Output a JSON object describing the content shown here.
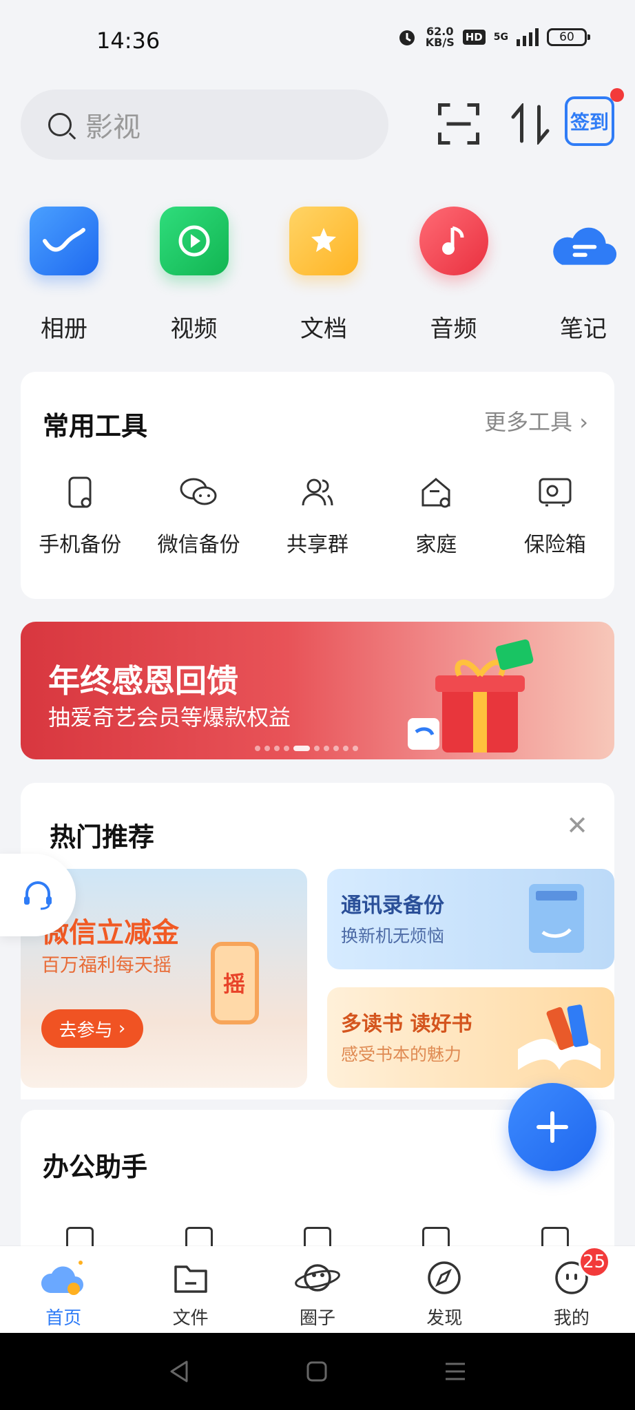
{
  "status_bar": {
    "time": "14:36",
    "speed_value": "62.0",
    "speed_unit": "KB/S",
    "hd": "HD",
    "network": "5G",
    "battery": "60"
  },
  "search": {
    "placeholder": "影视"
  },
  "quick_entries": [
    {
      "label": "相册",
      "icon": "album-icon",
      "color": "#2f7cf6"
    },
    {
      "label": "视频",
      "icon": "video-icon",
      "color": "#19c463"
    },
    {
      "label": "文档",
      "icon": "document-folder-icon",
      "color": "#ffc43d"
    },
    {
      "label": "音频",
      "icon": "music-icon",
      "color": "#f6414f"
    },
    {
      "label": "笔记",
      "icon": "note-cloud-icon",
      "color": "#2f7cf6"
    }
  ],
  "common_tools": {
    "title": "常用工具",
    "more": "更多工具",
    "items": [
      "手机备份",
      "微信备份",
      "共享群",
      "家庭",
      "保险箱"
    ]
  },
  "banner": {
    "title": "年终感恩回馈",
    "subtitle": "抽爱奇艺会员等爆款权益"
  },
  "hot": {
    "title": "热门推荐",
    "big": {
      "title": "微信立减金",
      "subtitle": "百万福利每天摇",
      "button": "去参与",
      "phone_text": "摇"
    },
    "small": [
      {
        "title": "通讯录备份",
        "subtitle": "换新机无烦恼"
      },
      {
        "title": "多读书 读好书",
        "subtitle": "感受书本的魅力"
      }
    ]
  },
  "office": {
    "title": "办公助手"
  },
  "tabs": [
    {
      "label": "首页",
      "icon": "home-cloud-icon",
      "active": true
    },
    {
      "label": "文件",
      "icon": "folder-icon"
    },
    {
      "label": "圈子",
      "icon": "planet-icon"
    },
    {
      "label": "发现",
      "icon": "compass-icon"
    },
    {
      "label": "我的",
      "icon": "profile-icon",
      "badge": "25"
    }
  ],
  "colors": {
    "accent": "#2f7cf6",
    "badge": "#f23a3a",
    "promo_orange": "#f05323"
  }
}
